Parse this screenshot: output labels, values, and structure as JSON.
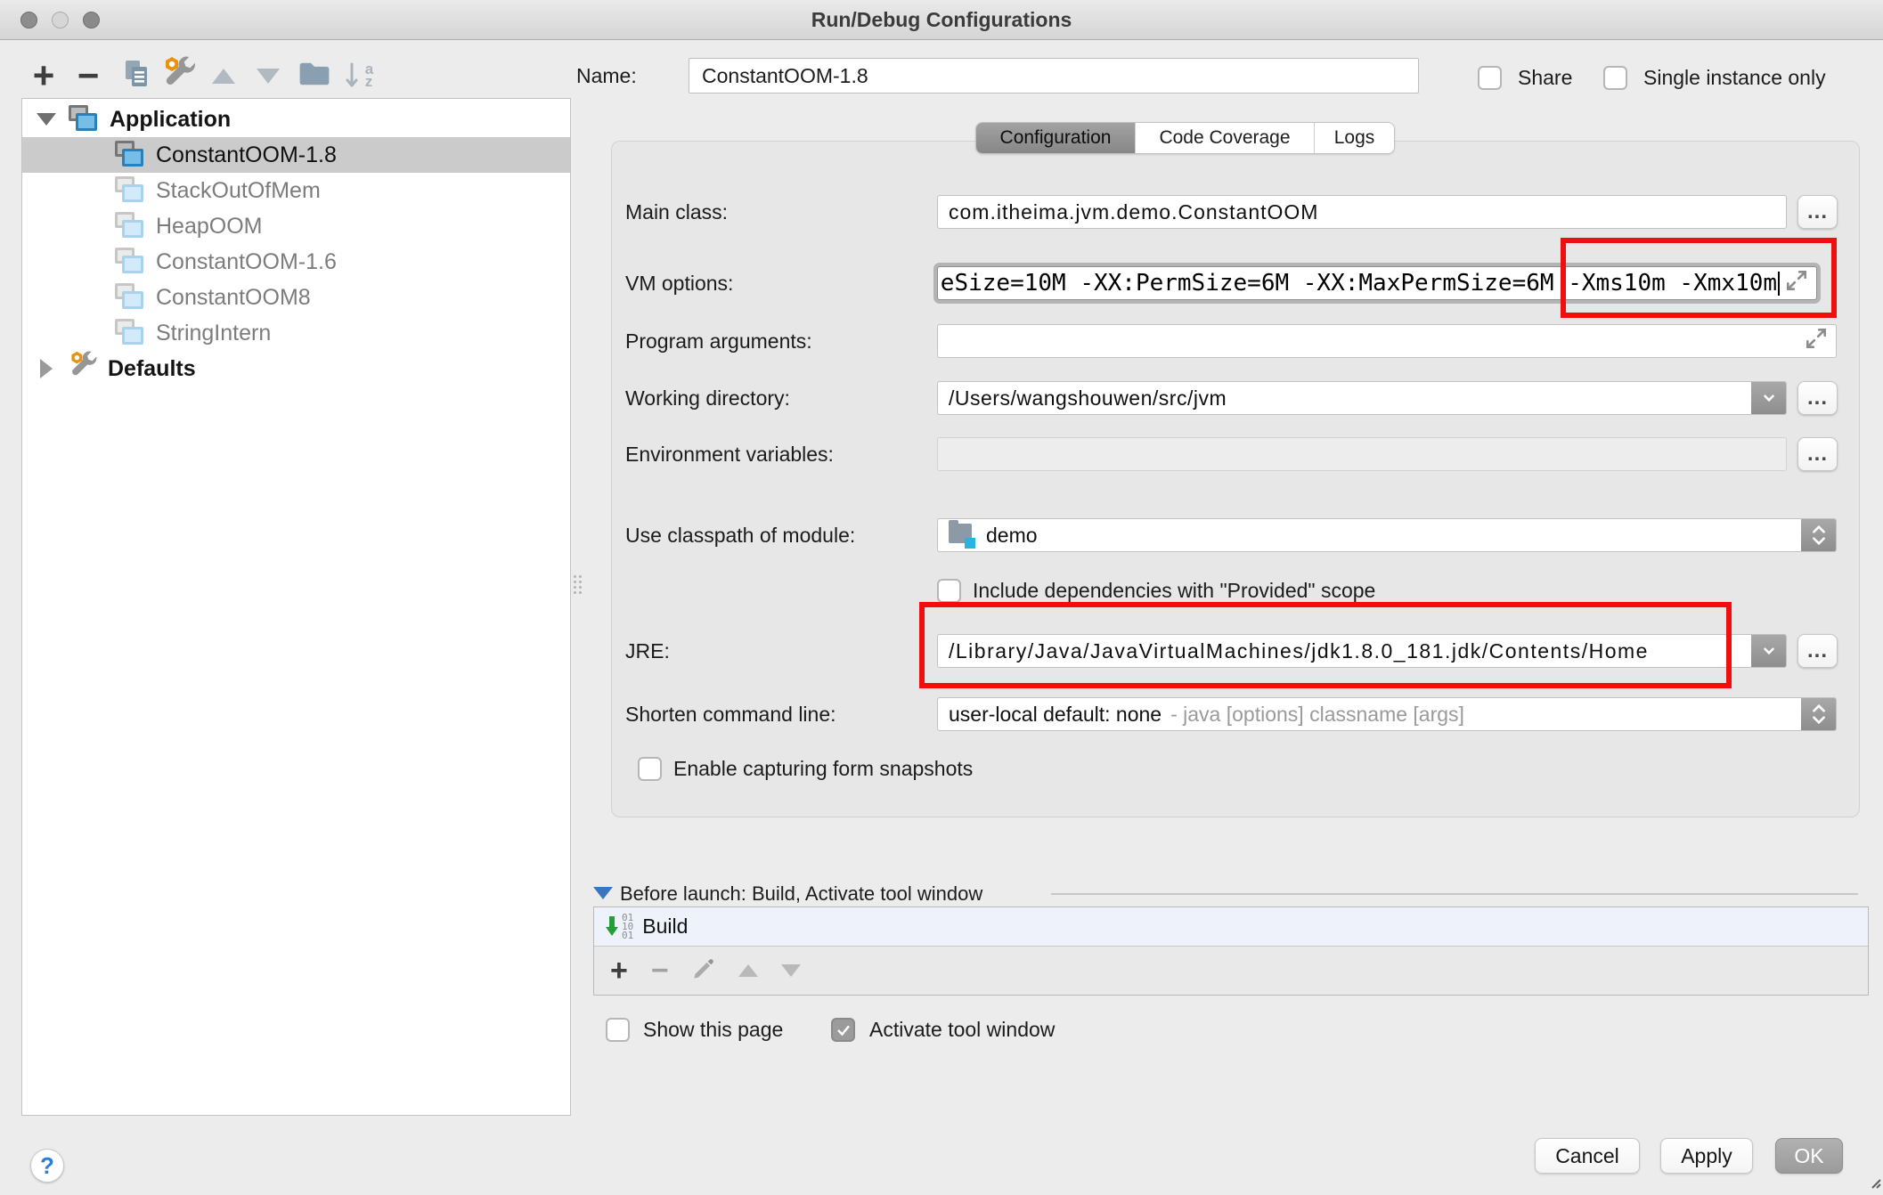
{
  "window": {
    "title": "Run/Debug Configurations"
  },
  "icons": {
    "add": "+",
    "remove": "−",
    "more": "...",
    "help": "?",
    "sort_a": "a",
    "sort_z": "z",
    "list_add": "+",
    "list_remove": "−",
    "build_digits": [
      "01",
      "10",
      "01"
    ]
  },
  "colors": {
    "annotation_red": "#f10e0e",
    "before_launch_arrow": "#3a76c0",
    "build_arrow_green": "#21a038"
  },
  "tree": {
    "group_label": "Application",
    "items": [
      {
        "label": "ConstantOOM-1.8",
        "selected": true
      },
      {
        "label": "StackOutOfMem",
        "selected": false
      },
      {
        "label": "HeapOOM",
        "selected": false
      },
      {
        "label": "ConstantOOM-1.6",
        "selected": false
      },
      {
        "label": "ConstantOOM8",
        "selected": false
      },
      {
        "label": "StringIntern",
        "selected": false
      }
    ],
    "defaults_label": "Defaults"
  },
  "header": {
    "name_label": "Name:",
    "name_value": "ConstantOOM-1.8",
    "share_label": "Share",
    "single_instance_label": "Single instance only"
  },
  "tabs": {
    "configuration": "Configuration",
    "code_coverage": "Code Coverage",
    "logs": "Logs"
  },
  "form": {
    "main_class": {
      "label": "Main class:",
      "value": "com.itheima.jvm.demo.ConstantOOM"
    },
    "vm_options": {
      "label": "VM options:",
      "value": "eSize=10M -XX:PermSize=6M -XX:MaxPermSize=6M -Xms10m -Xmx10m"
    },
    "program_arguments": {
      "label": "Program arguments:",
      "value": ""
    },
    "working_directory": {
      "label": "Working directory:",
      "value": "/Users/wangshouwen/src/jvm"
    },
    "environment_variables": {
      "label": "Environment variables:",
      "value": ""
    },
    "use_classpath": {
      "label": "Use classpath of module:",
      "value": "demo"
    },
    "provided_scope": {
      "label": "Include dependencies with \"Provided\" scope",
      "checked": false
    },
    "jre": {
      "label": "JRE:",
      "value": "/Library/Java/JavaVirtualMachines/jdk1.8.0_181.jdk/Contents/Home"
    },
    "shorten_command_line": {
      "label": "Shorten command line:",
      "value": "user-local default: none",
      "hint": "- java [options] classname [args]"
    },
    "snapshots": {
      "label": "Enable capturing form snapshots",
      "checked": false
    }
  },
  "before_launch": {
    "title": "Before launch: Build, Activate tool window",
    "build_item": "Build",
    "show_this_page_label": "Show this page",
    "show_this_page_checked": false,
    "activate_tool_window_label": "Activate tool window",
    "activate_tool_window_checked": true
  },
  "footer": {
    "help_label": "?",
    "cancel_label": "Cancel",
    "apply_label": "Apply",
    "ok_label": "OK"
  }
}
